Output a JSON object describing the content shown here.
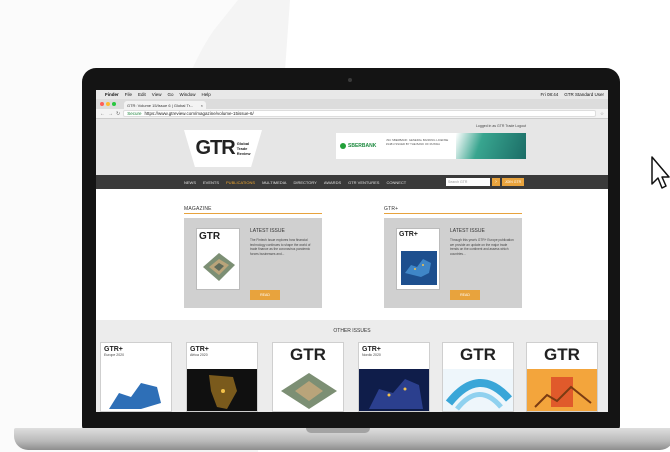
{
  "menubar": {
    "apple_glyph": "",
    "items": [
      "Finder",
      "File",
      "Edit",
      "View",
      "Go",
      "Window",
      "Help"
    ],
    "time": "Fri 08:44",
    "user": "GTR Standard User"
  },
  "browser": {
    "tab_title": "GTR: Volume 15/Issue 6 | Global Tr...",
    "secure_label": "Secure",
    "url": "https://www.gtreview.com/magazine/volume-15issue-6/"
  },
  "site": {
    "login_text": "Logged in as GTR Trade  Logout",
    "logo_text": "GTR",
    "logo_subtitle": [
      "Global",
      "Trade",
      "Review"
    ],
    "banner": {
      "logo": "SBERBANK",
      "text": "JSC SBERBANK: GENERAL BANKING LICENSE #1481 ISSUED BY THE BANK OF RUSSIA"
    },
    "nav": [
      "NEWS",
      "EVENTS",
      "PUBLICATIONS",
      "MULTIMEDIA",
      "DIRECTORY",
      "AWARDS",
      "GTR VENTURES",
      "CONNECT"
    ],
    "active_nav": "PUBLICATIONS",
    "search_placeholder": "Search GTR",
    "join_label": "JOIN GTR"
  },
  "magazine": {
    "section": "MAGAZINE",
    "card_title": "LATEST ISSUE",
    "description": "The Fintech Issue explores how financial technology continues to shape the world of trade finance as the coronavirus pandemic forces businesses and...",
    "read_label": "READ",
    "cover_text": "GTR"
  },
  "gtrplus": {
    "section": "GTR+",
    "card_title": "LATEST ISSUE",
    "description": "Through this year's GTR+ Europe publication we provide an update on the major trade trends on the continent and assess which countries...",
    "read_label": "READ",
    "cover_text": "GTR+"
  },
  "other_issues": {
    "title": "OTHER ISSUES",
    "items": [
      {
        "head": "GTR+",
        "sub": "Europe 2020"
      },
      {
        "head": "GTR+",
        "sub": "Africa 2020"
      },
      {
        "head": "GTR",
        "sub": ""
      },
      {
        "head": "GTR+",
        "sub": "Nordic 2020"
      },
      {
        "head": "GTR",
        "sub": ""
      },
      {
        "head": "GTR",
        "sub": ""
      }
    ]
  },
  "colors": {
    "accent": "#e8a33d",
    "nav_bg": "#3a3a3a",
    "swoosh": "#f5f5f5"
  }
}
